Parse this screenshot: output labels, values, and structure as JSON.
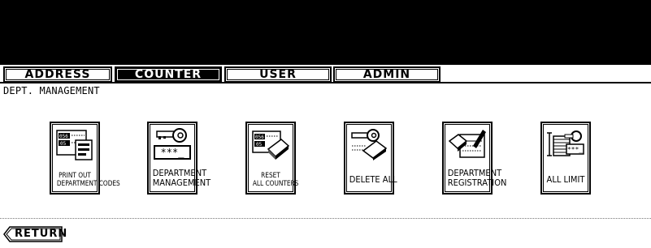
{
  "tabs": [
    {
      "label": "ADDRESS",
      "active": false
    },
    {
      "label": "COUNTER",
      "active": true
    },
    {
      "label": "USER",
      "active": false
    },
    {
      "label": "ADMIN",
      "active": false
    }
  ],
  "breadcrumb": "DEPT. MANAGEMENT",
  "tiles": [
    {
      "line1": "PRINT OUT",
      "line2": "DEPARTMENT CODES",
      "icon": "print-codes-icon"
    },
    {
      "line1": "DEPARTMENT",
      "line2": "MANAGEMENT",
      "icon": "key-password-icon"
    },
    {
      "line1": "RESET",
      "line2": "ALL COUNTERS",
      "icon": "eraser-counter-icon"
    },
    {
      "line1": "DELETE ALL",
      "line2": "",
      "icon": "key-eraser-icon"
    },
    {
      "line1": "DEPARTMENT",
      "line2": "REGISTRATION",
      "icon": "register-pen-icon"
    },
    {
      "line1": "ALL LIMIT",
      "line2": "",
      "icon": "limit-stack-icon"
    }
  ],
  "return_label": "RETURN",
  "icon_text": {
    "code_a": "056",
    "code_b": "05",
    "stars": "***_"
  }
}
